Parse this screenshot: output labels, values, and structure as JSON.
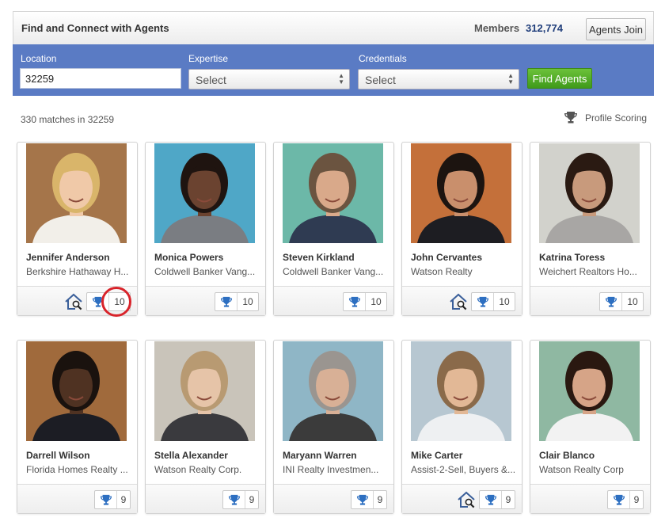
{
  "header": {
    "title": "Find and Connect with Agents",
    "members_label": "Members",
    "members_count": "312,774",
    "join_label": "Agents Join"
  },
  "search": {
    "location_label": "Location",
    "location_value": "32259",
    "expertise_label": "Expertise",
    "expertise_value": "Select",
    "credentials_label": "Credentials",
    "credentials_value": "Select",
    "find_label": "Find Agents"
  },
  "results": {
    "matches_text": "330 matches in 32259",
    "profile_scoring_label": "Profile Scoring"
  },
  "agents": [
    {
      "name": "Jennifer Anderson",
      "company": "Berkshire Hathaway H...",
      "score": "10",
      "has_house": true,
      "hair": "#d9b56a",
      "skin": "#f0c9a8",
      "shirt": "#f2efe9",
      "bg": "#a5754a"
    },
    {
      "name": "Monica Powers",
      "company": "Coldwell Banker Vang...",
      "score": "10",
      "has_house": false,
      "hair": "#1f1410",
      "skin": "#6b4330",
      "shirt": "#7a7d82",
      "bg": "#4fa7c7"
    },
    {
      "name": "Steven Kirkland",
      "company": "Coldwell Banker Vang...",
      "score": "10",
      "has_house": false,
      "hair": "#6b5440",
      "skin": "#d9a98a",
      "shirt": "#2f3b52",
      "bg": "#6cb8a8"
    },
    {
      "name": "John Cervantes",
      "company": "Watson Realty",
      "score": "10",
      "has_house": true,
      "hair": "#1c1410",
      "skin": "#c98f6c",
      "shirt": "#1d1d22",
      "bg": "#c4703a"
    },
    {
      "name": "Katrina Toress",
      "company": "Weichert Realtors Ho...",
      "score": "10",
      "has_house": false,
      "hair": "#2a1a12",
      "skin": "#c89a7c",
      "shirt": "#a8a6a4",
      "bg": "#d2d2cc"
    },
    {
      "name": "Darrell Wilson",
      "company": "Florida Homes Realty ...",
      "score": "9",
      "has_house": false,
      "hair": "#1a120e",
      "skin": "#4f3222",
      "shirt": "#1c1d24",
      "bg": "#a06a3c"
    },
    {
      "name": "Stella Alexander",
      "company": "Watson Realty Corp.",
      "score": "9",
      "has_house": false,
      "hair": "#b89a72",
      "skin": "#e6c4a8",
      "shirt": "#3a3a3e",
      "bg": "#c9c4ba"
    },
    {
      "name": "Maryann Warren",
      "company": "INI Realty Investmen...",
      "score": "9",
      "has_house": false,
      "hair": "#9a9590",
      "skin": "#d8b096",
      "shirt": "#3b3b3b",
      "bg": "#8fb6c6"
    },
    {
      "name": "Mike Carter",
      "company": "Assist-2-Sell, Buyers &...",
      "score": "9",
      "has_house": true,
      "hair": "#8a6a4a",
      "skin": "#e2b896",
      "shirt": "#eef0f2",
      "bg": "#b7c7d1"
    },
    {
      "name": "Clair Blanco",
      "company": "Watson Realty Corp",
      "score": "9",
      "has_house": false,
      "hair": "#2a1810",
      "skin": "#d6a487",
      "shirt": "#f2f2f2",
      "bg": "#8fb8a2"
    }
  ],
  "colors": {
    "search_bar": "#5a7bc4",
    "find_button": "#4fab24",
    "trophy": "#2d6fc1",
    "highlight": "#d8232a"
  }
}
